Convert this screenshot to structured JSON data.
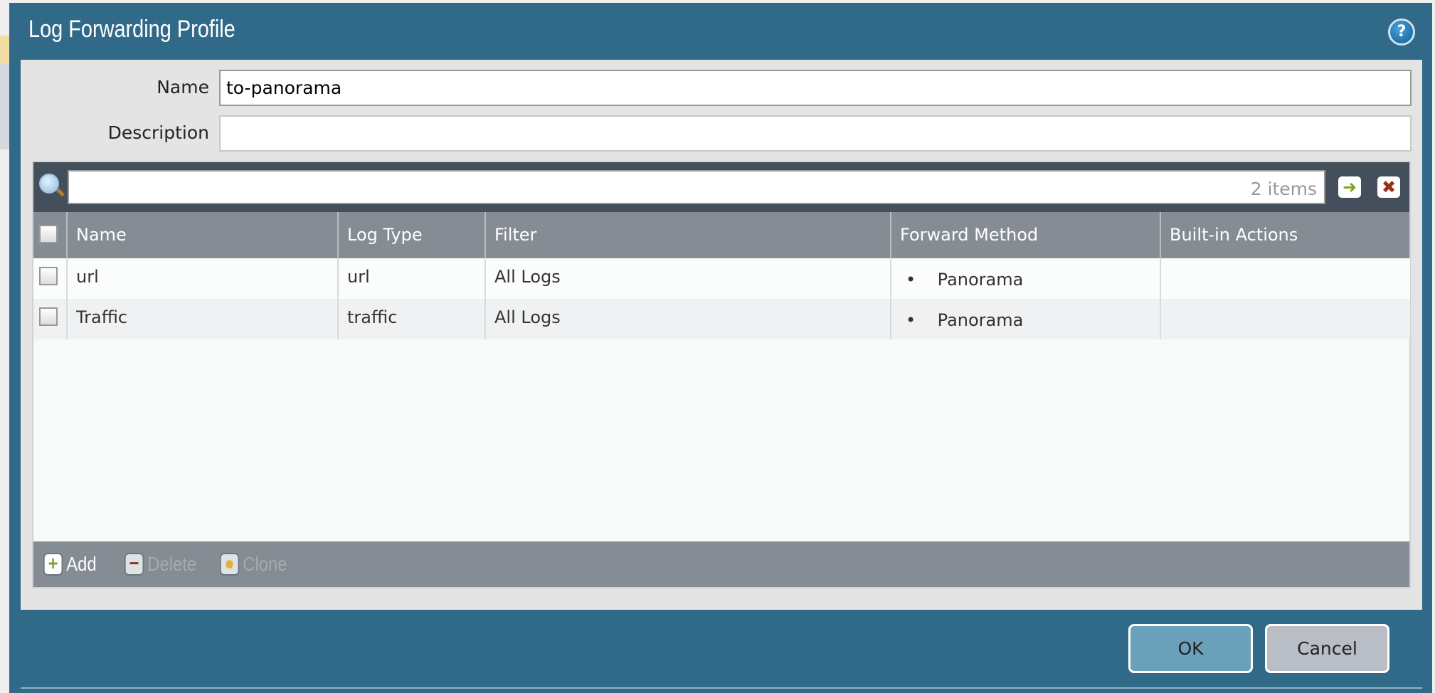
{
  "dialog": {
    "title": "Log Forwarding Profile",
    "help_icon": "help-icon"
  },
  "form": {
    "name_label": "Name",
    "name_value": "to-panorama",
    "description_label": "Description",
    "description_value": ""
  },
  "grid": {
    "search_value": "",
    "item_count": "2 items",
    "columns": [
      "Name",
      "Log Type",
      "Filter",
      "Forward Method",
      "Built-in Actions"
    ],
    "rows": [
      {
        "name": "url",
        "log_type": "url",
        "filter": "All Logs",
        "forward_method": "Panorama",
        "built_in_actions": ""
      },
      {
        "name": "Traffic",
        "log_type": "traffic",
        "filter": "All Logs",
        "forward_method": "Panorama",
        "built_in_actions": ""
      }
    ],
    "actions": {
      "add": "Add",
      "delete": "Delete",
      "clone": "Clone"
    }
  },
  "buttons": {
    "ok": "OK",
    "cancel": "Cancel"
  },
  "colors": {
    "dialog": "#316a88",
    "header": "#868c93",
    "toolbar": "#434f5a",
    "ok": "#6aa0b9",
    "cancel": "#b9bec6"
  }
}
